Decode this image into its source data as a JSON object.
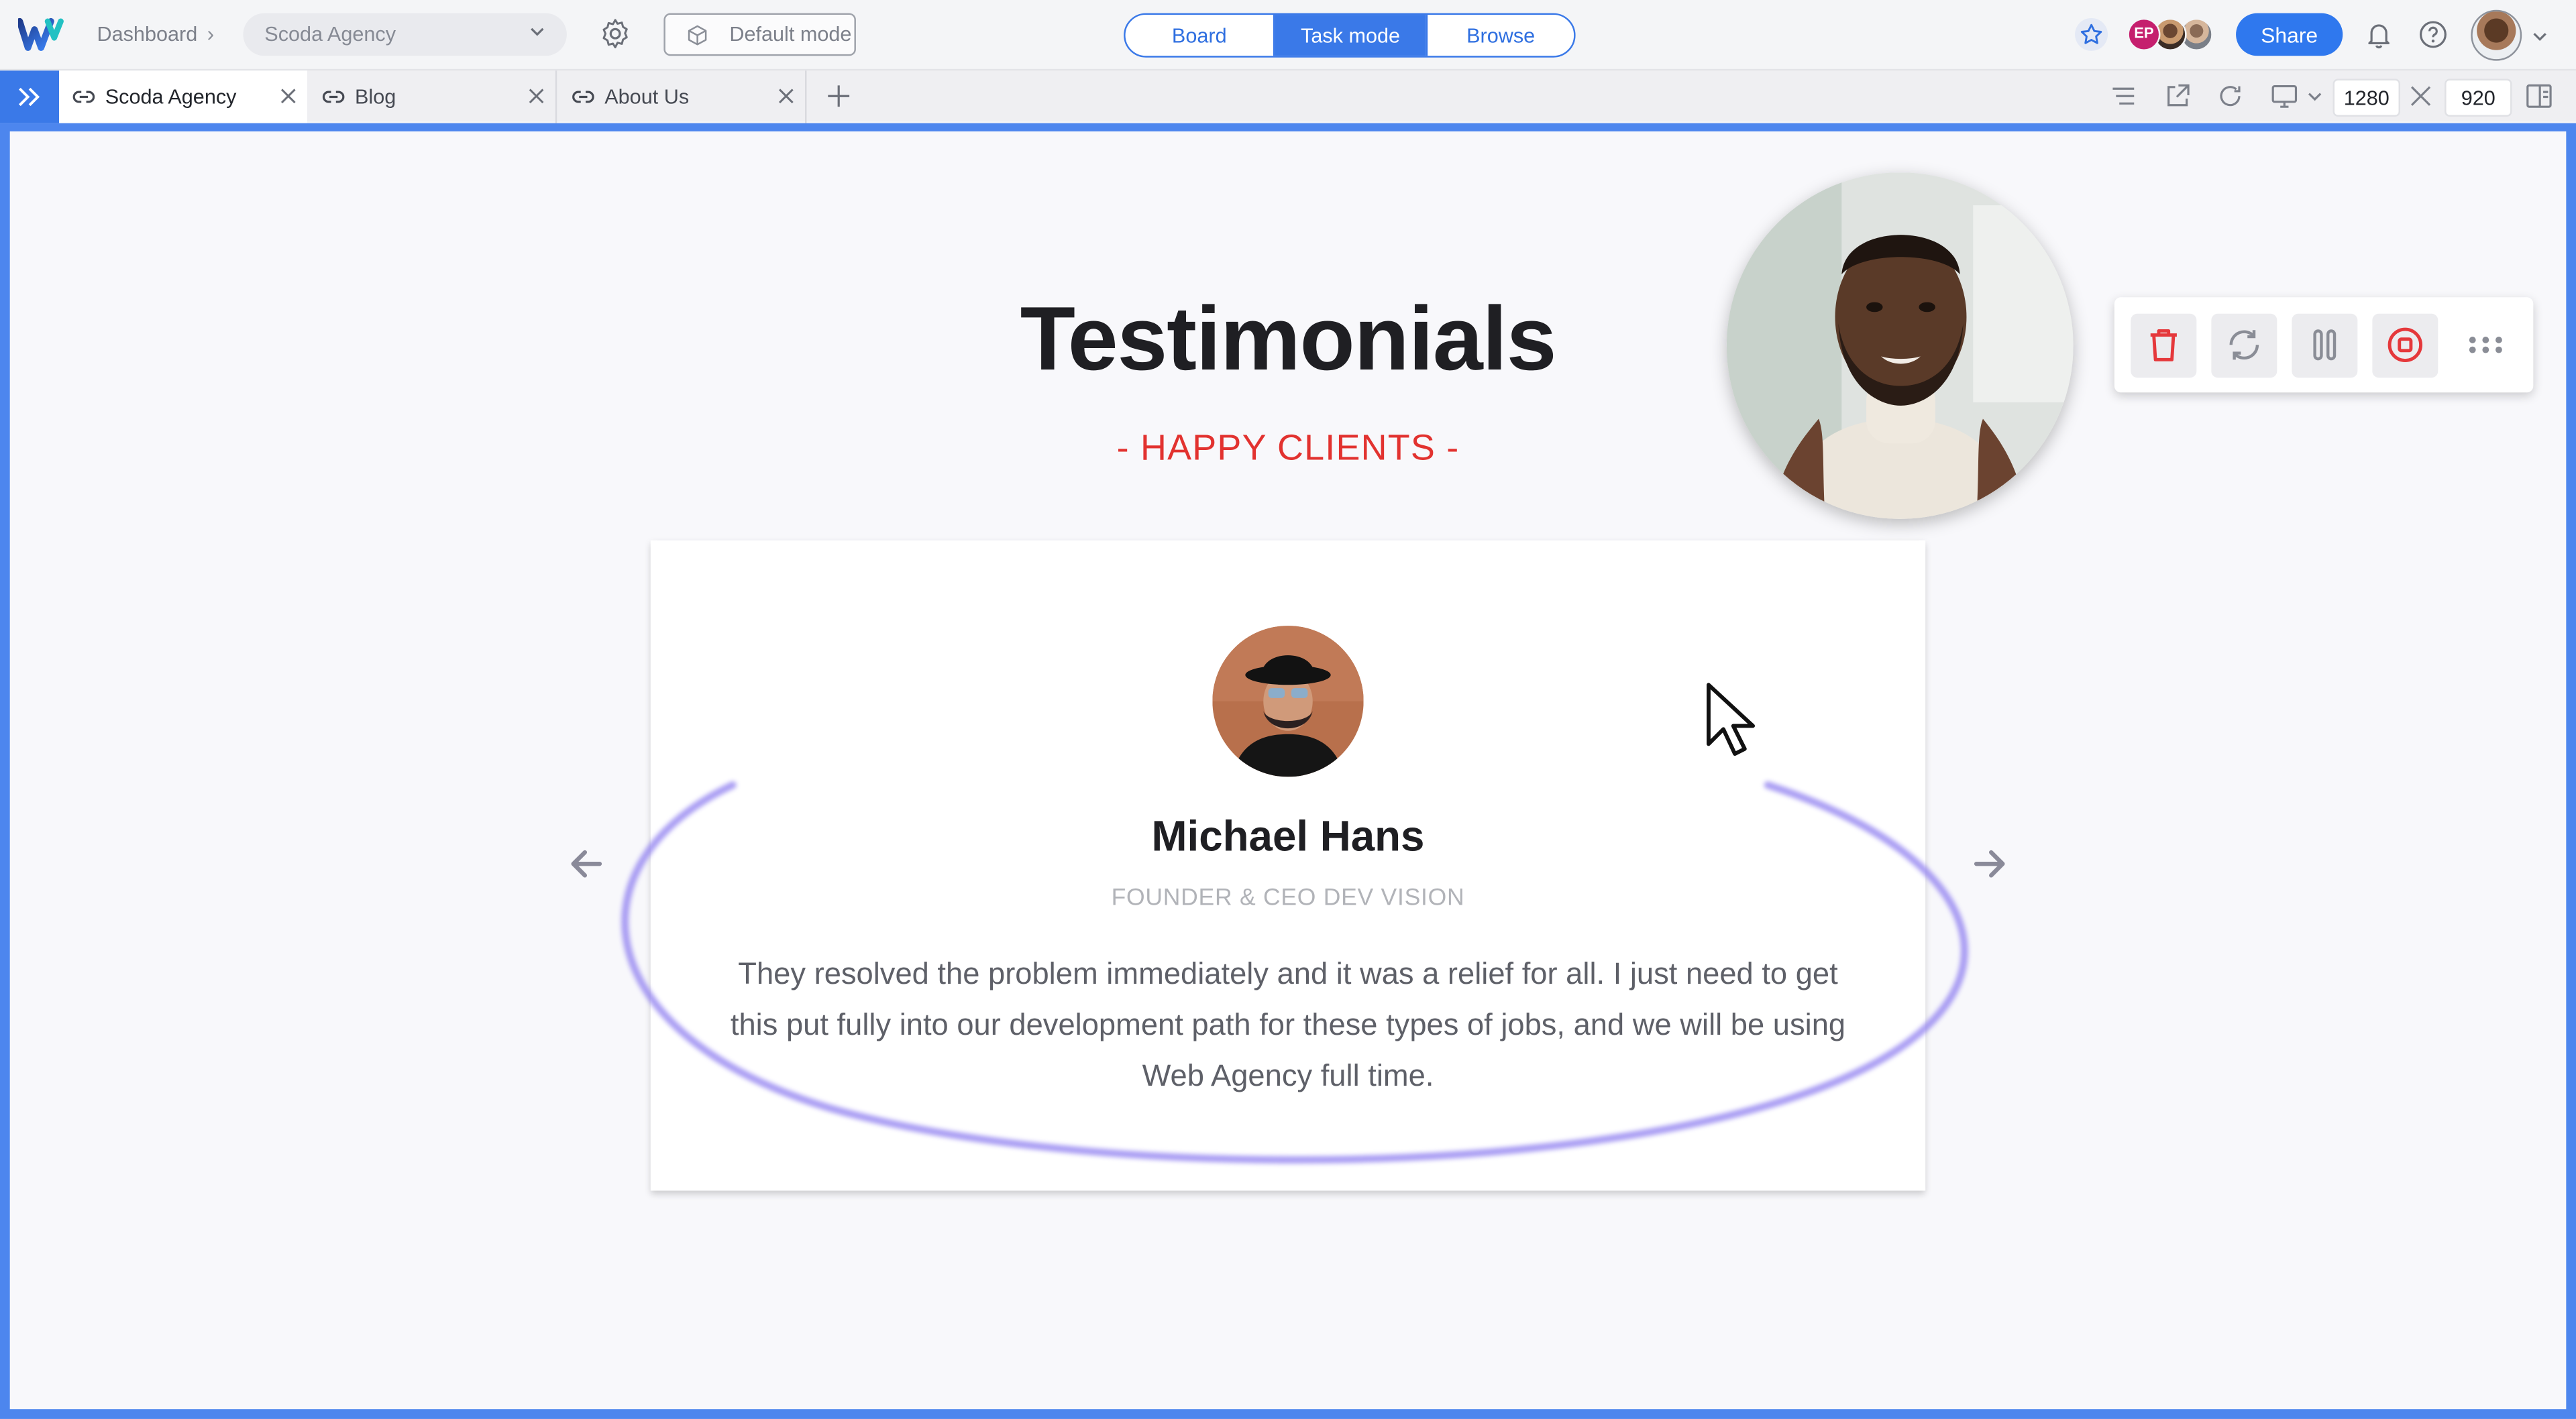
{
  "topbar": {
    "breadcrumb_root": "Dashboard",
    "project": "Scoda Agency",
    "mode_button": "Default mode",
    "segments": [
      "Board",
      "Task mode",
      "Browse"
    ],
    "active_segment": "Task mode",
    "avatar_initials": "EP",
    "share_label": "Share"
  },
  "tabs": [
    {
      "label": "Scoda Agency",
      "active": true
    },
    {
      "label": "Blog",
      "active": false
    },
    {
      "label": "About Us",
      "active": false
    }
  ],
  "viewport": {
    "width": "1280",
    "height": "920"
  },
  "page": {
    "title": "Testimonials",
    "subtitle": "- HAPPY CLIENTS -",
    "testimonial": {
      "name": "Michael Hans",
      "role": "FOUNDER & CEO DEV VISION",
      "quote": "They resolved the problem immediately and it was a relief for all. I just need to get this put fully into our development path for these types of jobs, and we will be using Web Agency full time."
    }
  },
  "colors": {
    "accent": "#3a79e8",
    "subtitle_red": "#e2322f",
    "annotation_oval": "#8f7ff0",
    "delete_red": "#e5383b"
  },
  "icons": [
    "webflow-logo-icon",
    "settings-gear-icon",
    "cube-icon",
    "star-icon",
    "bell-icon",
    "help-icon",
    "link-icon",
    "close-icon",
    "plus-icon",
    "list-icon",
    "external-link-icon",
    "refresh-icon",
    "monitor-icon",
    "split-view-icon",
    "arrow-left-icon",
    "arrow-right-icon",
    "trash-icon",
    "restart-icon",
    "pause-icon",
    "stop-icon",
    "more-icon",
    "mouse-cursor-icon"
  ]
}
